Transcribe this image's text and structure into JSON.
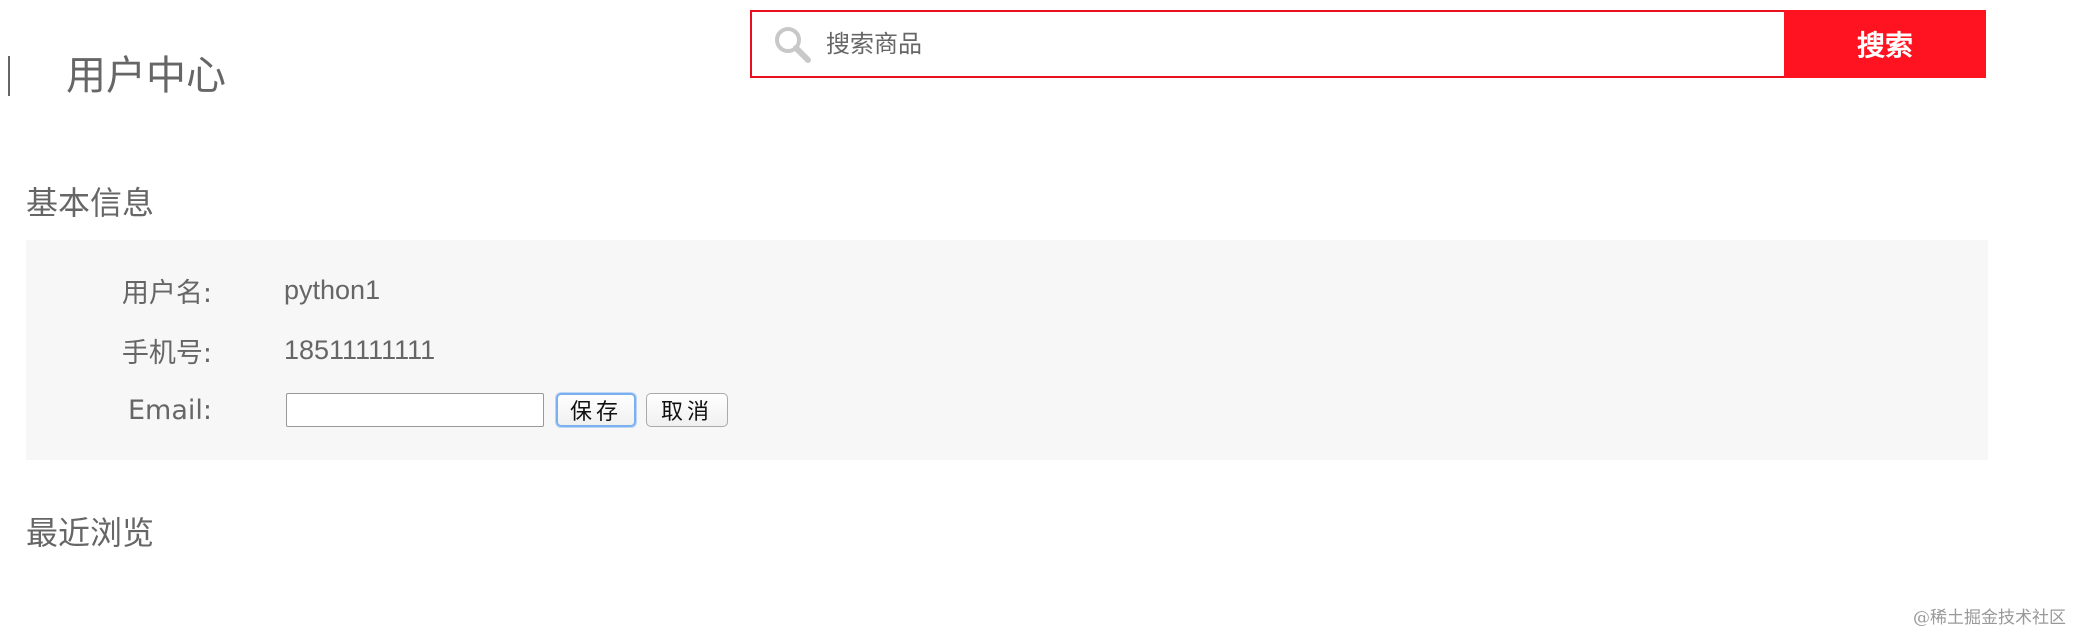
{
  "header": {
    "title": "用户中心",
    "search": {
      "placeholder": "搜索商品",
      "value": "",
      "button_label": "搜索"
    }
  },
  "basic_info": {
    "heading": "基本信息",
    "username_label": "用户名:",
    "username_value": "python1",
    "phone_label": "手机号:",
    "phone_value": "18511111111",
    "email_label": "Email:",
    "email_value": "",
    "save_label": "保存",
    "cancel_label": "取消"
  },
  "recent": {
    "heading": "最近浏览"
  },
  "watermark": "@稀土掘金技术社区",
  "colors": {
    "accent": "#ff1321",
    "accent_border": "#e8101e",
    "panel_bg": "#f7f7f7",
    "text": "#666666"
  },
  "icons": {
    "search": "search-icon"
  }
}
